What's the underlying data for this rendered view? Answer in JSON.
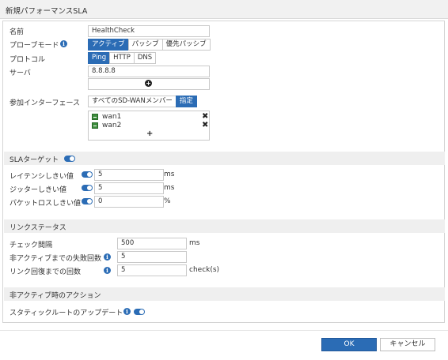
{
  "dialog": {
    "title": "新規パフォーマンスSLA"
  },
  "form": {
    "name": {
      "label": "名前",
      "value": "HealthCheck"
    },
    "probe_mode": {
      "label": "プローブモード",
      "options": [
        "アクティブ",
        "パッシブ",
        "優先パッシブ"
      ],
      "selected": "アクティブ"
    },
    "protocol": {
      "label": "プロトコル",
      "options": [
        "Ping",
        "HTTP",
        "DNS"
      ],
      "selected": "Ping"
    },
    "server": {
      "label": "サーバ",
      "values": [
        "8.8.8.8",
        ""
      ]
    },
    "members": {
      "label": "参加インターフェース",
      "mode_options": [
        "すべてのSD-WANメンバー",
        "指定"
      ],
      "selected": "指定",
      "interfaces": [
        "wan1",
        "wan2"
      ]
    }
  },
  "sla_target": {
    "header": "SLAターゲット",
    "latency": {
      "label": "レイテンシしきい値",
      "value": "5",
      "unit": "ms"
    },
    "jitter": {
      "label": "ジッターしきい値",
      "value": "5",
      "unit": "ms"
    },
    "packet_loss": {
      "label": "パケットロスしきい値",
      "value": "0",
      "unit": "%"
    }
  },
  "link_status": {
    "header": "リンクステータス",
    "interval": {
      "label": "チェック間隔",
      "value": "500",
      "unit": "ms"
    },
    "failures": {
      "label": "非アクティブまでの失敗回数",
      "value": "5"
    },
    "recovery": {
      "label": "リンク回復までの回数",
      "value": "5",
      "unit": "check(s)"
    }
  },
  "inactive_actions": {
    "header": "非アクティブ時のアクション",
    "static_route_update": {
      "label": "スタティックルートのアップデート"
    }
  },
  "buttons": {
    "ok": "OK",
    "cancel": "キャンセル"
  },
  "icons": {
    "info": "info-icon",
    "toggle": "toggle-on-icon",
    "add": "add-icon",
    "remove": "remove-icon",
    "interface": "interface-icon"
  },
  "colors": {
    "accent": "#2b6cb5",
    "section_bg": "#efefef"
  }
}
